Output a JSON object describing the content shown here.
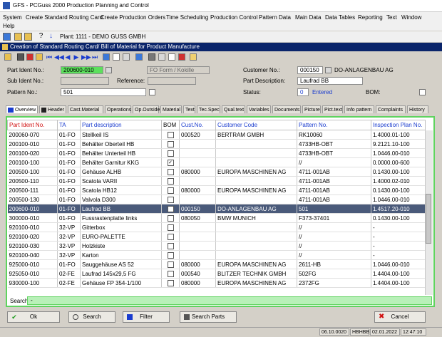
{
  "window": {
    "title": "GFS - PCGuss 2000 Production Planning and Control"
  },
  "menu": [
    "System",
    "Create Standard Routing Card",
    "Create Production Orders",
    "Time Scheduling",
    "Production Control",
    "Pattern Data",
    "Main Data",
    "Data Tables",
    "Reporting",
    "Text",
    "Window",
    "Help"
  ],
  "toolbar": {
    "plant_label": "Plant:",
    "plant_value": "1111 - DEMO GUSS GMBH"
  },
  "form_caption": "Creation of Standard Routing Card/ Bill of Material for Product Manufacture",
  "form": {
    "part_ident_label": "Part Ident No.:",
    "part_ident_value": "200600-010",
    "form_type_value": "FO Form / Kokille",
    "customer_no_label": "Customer No.:",
    "customer_no_value": "000150",
    "customer_name": "DO-ANLAGENBAU AG",
    "sub_ident_label": "Sub Ident No.:",
    "sub_ident_value": "",
    "reference_label": "Reference:",
    "reference_value": "",
    "part_description_label": "Part Description:",
    "part_description_value": "Laufrad BB",
    "pattern_no_label": "Pattern No.:",
    "pattern_no_value": "501",
    "status_label": "Status:",
    "status_code": "0",
    "status_text": "Entered",
    "bom_label": "BOM:"
  },
  "tabs": [
    "Overview",
    "Header",
    "Cast.Material",
    "Operations",
    "Op.Outside",
    "Material",
    "Text",
    "Tec.Spec",
    "Qual.text",
    "Variables",
    "Documents",
    "Picture",
    "Pict.text",
    "Info pattern",
    "Complaints",
    "History"
  ],
  "grid": {
    "columns": [
      "Part Ident No.",
      "TA",
      "Part description",
      "BOM",
      "Cust.No.",
      "Customer Code",
      "Pattern No.",
      "Inspection Plan No."
    ],
    "rows": [
      [
        "200060-070",
        "01-FO",
        "Stellkeil IS",
        "",
        "000520",
        "BERTRAM GMBH",
        "RK10060",
        "1.4000.01-100"
      ],
      [
        "200100-010",
        "01-FO",
        "Behälter Oberteil HB",
        "",
        "",
        "",
        "4733HB-OBT",
        "9.2121.10-100"
      ],
      [
        "200100-020",
        "01-FO",
        "Behälter Unterteil HB",
        "",
        "",
        "",
        "4733HB-OBT",
        "1.0446.00-010"
      ],
      [
        "200100-100",
        "01-FO",
        "Behälter Garnitur KKG",
        "✓",
        "",
        "",
        "//",
        "0.0000.00-600"
      ],
      [
        "200500-100",
        "01-FO",
        "Gehäuse ALHB",
        "",
        "080000",
        "EUROPA MASCHINEN AG",
        "4711-001AB",
        "0.1430.00-100"
      ],
      [
        "200500-110",
        "01-FO",
        "Scatola VARII",
        "",
        "",
        "",
        "4711-001AB",
        "1.4000.02-010"
      ],
      [
        "200500-111",
        "01-FO",
        "Scatola HB12",
        "",
        "080000",
        "EUROPA MASCHINEN AG",
        "4711-001AB",
        "0.1430.00-100"
      ],
      [
        "200500-130",
        "01-FO",
        "Valvola D300",
        "",
        "",
        "",
        "4711-001AB",
        "1.0446.00-010"
      ],
      [
        "200600-010",
        "01-FO",
        "Laufrad BB",
        "",
        "000150",
        "DO-ANLAGENBAU AG",
        "501",
        "1.4517.20-010"
      ],
      [
        "300000-010",
        "01-FO",
        "Fussrastenplatte links",
        "",
        "080050",
        "BMW MUNICH",
        "F373-37401",
        "0.1430.00-100"
      ],
      [
        "920100-010",
        "32-VP",
        "Gitterbox",
        "",
        "",
        "",
        "//",
        "-"
      ],
      [
        "920100-020",
        "32-VP",
        "EURO-PALETTE",
        "",
        "",
        "",
        "//",
        "-"
      ],
      [
        "920100-030",
        "32-VP",
        "Holzkiste",
        "",
        "",
        "",
        "//",
        "-"
      ],
      [
        "920100-040",
        "32-VP",
        "Karton",
        "",
        "",
        "",
        "//",
        "-"
      ],
      [
        "925000-010",
        "01-FO",
        "Sauggehäuse AS 52",
        "",
        "080000",
        "EUROPA MASCHINEN AG",
        "2611-HB",
        "1.0446.00-010"
      ],
      [
        "925050-010",
        "02-FE",
        "Laufrad 145x29,5 FG",
        "",
        "000540",
        "BLITZER TECHNIK GMBH",
        "502FG",
        "1.4404.00-100"
      ],
      [
        "930000-100",
        "02-FE",
        "Gehäuse FP 354-1/100",
        "",
        "080000",
        "EUROPA MASCHINEN AG",
        "2372FG",
        "1.4404.00-100"
      ]
    ],
    "selected_row": 8
  },
  "search": {
    "label": "Search:",
    "value": "-"
  },
  "buttons": {
    "ok": "Ok",
    "search": "Search",
    "filter": "Filter",
    "search_parts": "Search Parts",
    "cancel": "Cancel"
  },
  "status": {
    "date": "06.10.0020",
    "user": "HBHBB",
    "date2": "02.01.2022",
    "time": "12:47:10"
  },
  "colors": {
    "accent_green": "#5fd35f",
    "selection": "#4a5a7a",
    "caption": "#0a246a",
    "header_text": "#1a3ccf",
    "key_header": "#d01010"
  }
}
